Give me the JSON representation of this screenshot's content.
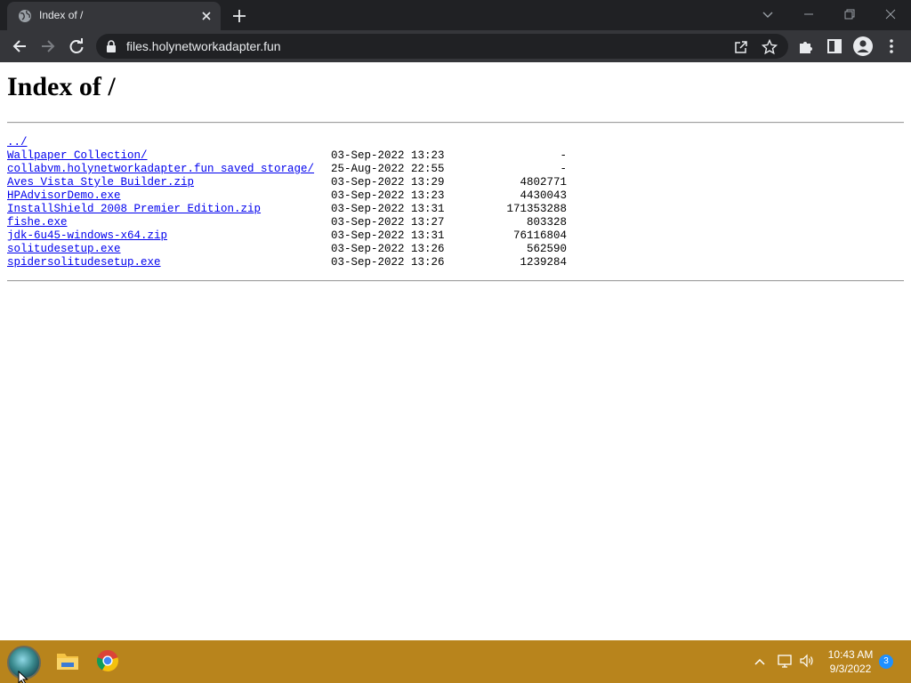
{
  "browser": {
    "tab_title": "Index of /",
    "url": "files.holynetworkadapter.fun"
  },
  "page": {
    "heading": "Index of /",
    "parent_link": "../",
    "entries": [
      {
        "name": "Wallpaper Collection/",
        "date": "03-Sep-2022 13:23",
        "size": "-"
      },
      {
        "name": "collabvm.holynetworkadapter.fun saved storage/",
        "date": "25-Aug-2022 22:55",
        "size": "-"
      },
      {
        "name": "Aves Vista Style Builder.zip",
        "date": "03-Sep-2022 13:29",
        "size": "4802771"
      },
      {
        "name": "HPAdvisorDemo.exe",
        "date": "03-Sep-2022 13:23",
        "size": "4430043"
      },
      {
        "name": "InstallShield_2008_Premier_Edition.zip",
        "date": "03-Sep-2022 13:31",
        "size": "171353288"
      },
      {
        "name": "fishe.exe",
        "date": "03-Sep-2022 13:27",
        "size": "803328"
      },
      {
        "name": "jdk-6u45-windows-x64.zip",
        "date": "03-Sep-2022 13:31",
        "size": "76116804"
      },
      {
        "name": "solitudesetup.exe",
        "date": "03-Sep-2022 13:26",
        "size": "562590"
      },
      {
        "name": "spidersolitudesetup.exe",
        "date": "03-Sep-2022 13:26",
        "size": "1239284"
      }
    ]
  },
  "taskbar": {
    "time": "10:43 AM",
    "date": "9/3/2022",
    "notification_count": "3"
  },
  "colors": {
    "tab_strip": "#202124",
    "toolbar": "#35363a",
    "link": "#0000ee",
    "taskbar": "#b8841c"
  }
}
